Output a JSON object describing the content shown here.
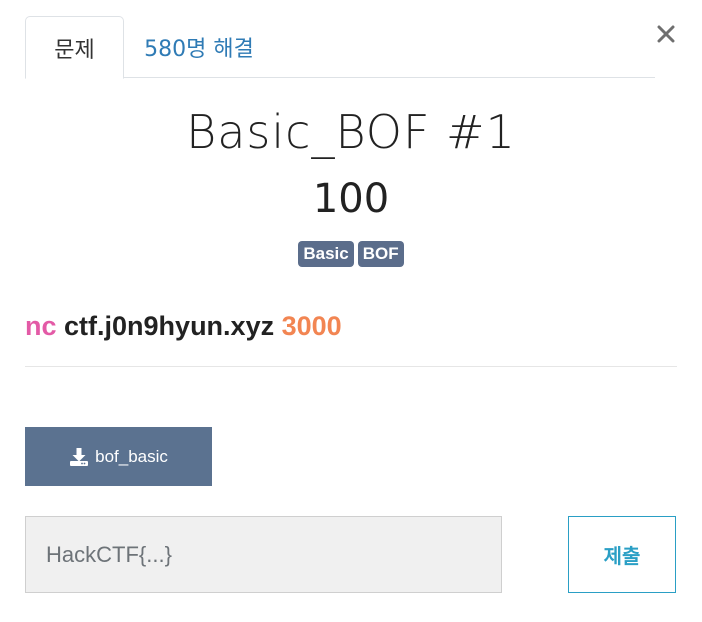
{
  "tabs": [
    {
      "label": "문제"
    },
    {
      "label": "580명 해결"
    }
  ],
  "challenge": {
    "title": "Basic_BOF #1",
    "points": "100",
    "tags": [
      "Basic",
      "BOF"
    ],
    "description": {
      "command": "nc",
      "host": "ctf.j0n9hyun.xyz",
      "port": "3000"
    }
  },
  "download": {
    "file_label": "bof_basic",
    "icon": "download-icon"
  },
  "flag_form": {
    "placeholder": "HackCTF{...}",
    "value": "",
    "submit_label": "제출"
  },
  "colors": {
    "tab_link": "#2f7bb5",
    "badge": "#5b6d8b",
    "command": "#e35aa6",
    "port": "#f28552",
    "download_button": "#5b7290",
    "submit": "#2a9fc5"
  }
}
